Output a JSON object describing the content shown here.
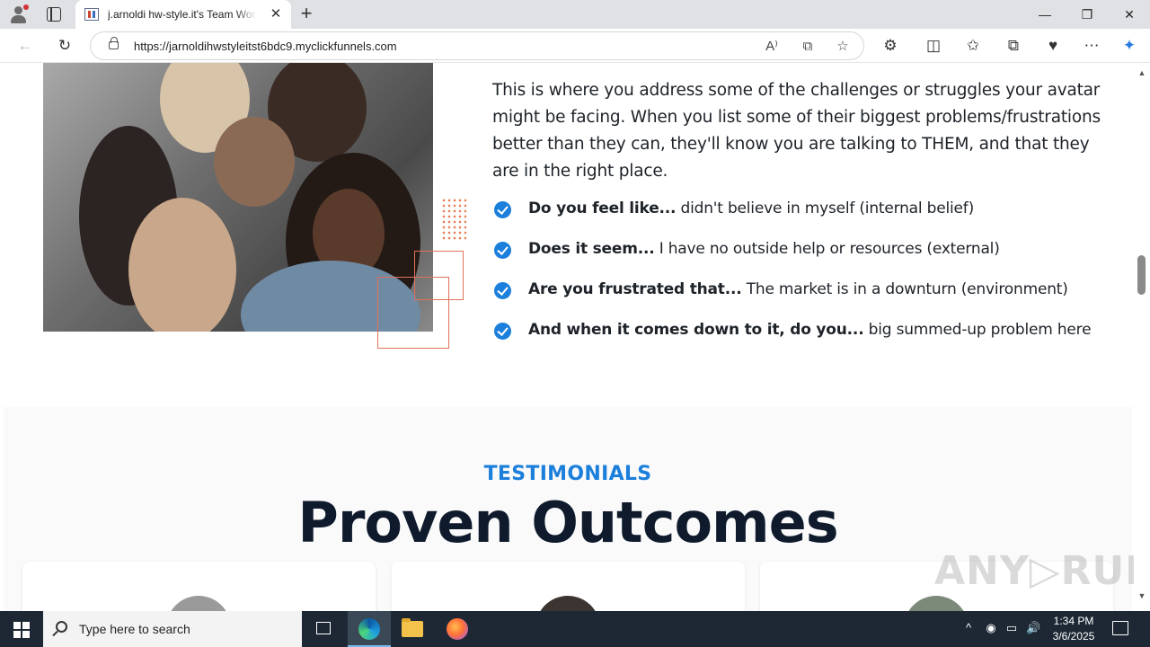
{
  "browser": {
    "tab_title": "j.arnoldi hw-style.it's Team Work",
    "tab_close": "✕",
    "new_tab": "+",
    "url": "https://jarnoldihwstyleitst6bdc9.myclickfunnels.com",
    "window_controls": {
      "minimize": "—",
      "restore": "❐",
      "close": "✕"
    },
    "nav_icons": {
      "back": "←",
      "refresh": "↻"
    },
    "url_icons": {
      "read_aloud": "A⁾",
      "immersive": "⧉",
      "favorite": "☆"
    },
    "toolbar_icons": {
      "extensions": "⚙",
      "split": "◫",
      "favorites": "✩",
      "collections": "⧉",
      "performance": "♥",
      "menu": "⋯",
      "copilot": "✦"
    }
  },
  "page": {
    "intro": "This is where you address some of the challenges or struggles your avatar might be facing.  When you list some of their biggest problems/frustrations better than they can, they'll know you are talking to THEM, and that they are in the right place.",
    "bullets": [
      {
        "bold": "Do you feel like...",
        "text": " didn't believe in myself (internal belief)"
      },
      {
        "bold": "Does it seem...",
        "text": " I have no outside help or resources (external)"
      },
      {
        "bold": "Are you frustrated that...",
        "text": " The market is in a downturn (environment)"
      },
      {
        "bold": "And when it comes down to it, do you...",
        "text": "  big summed-up problem here"
      }
    ],
    "testimonials": {
      "eyebrow": "TESTIMONIALS",
      "headline": "Proven Outcomes"
    },
    "watermark": "ANY▷RUN",
    "accent_color": "#1b7fdb",
    "decor_color": "#e2715a"
  },
  "taskbar": {
    "search_placeholder": "Type here to search",
    "time": "1:34 PM",
    "date": "3/6/2025",
    "tray_icons": {
      "chevron": "^",
      "network": "▭",
      "volume": "🔊"
    }
  }
}
